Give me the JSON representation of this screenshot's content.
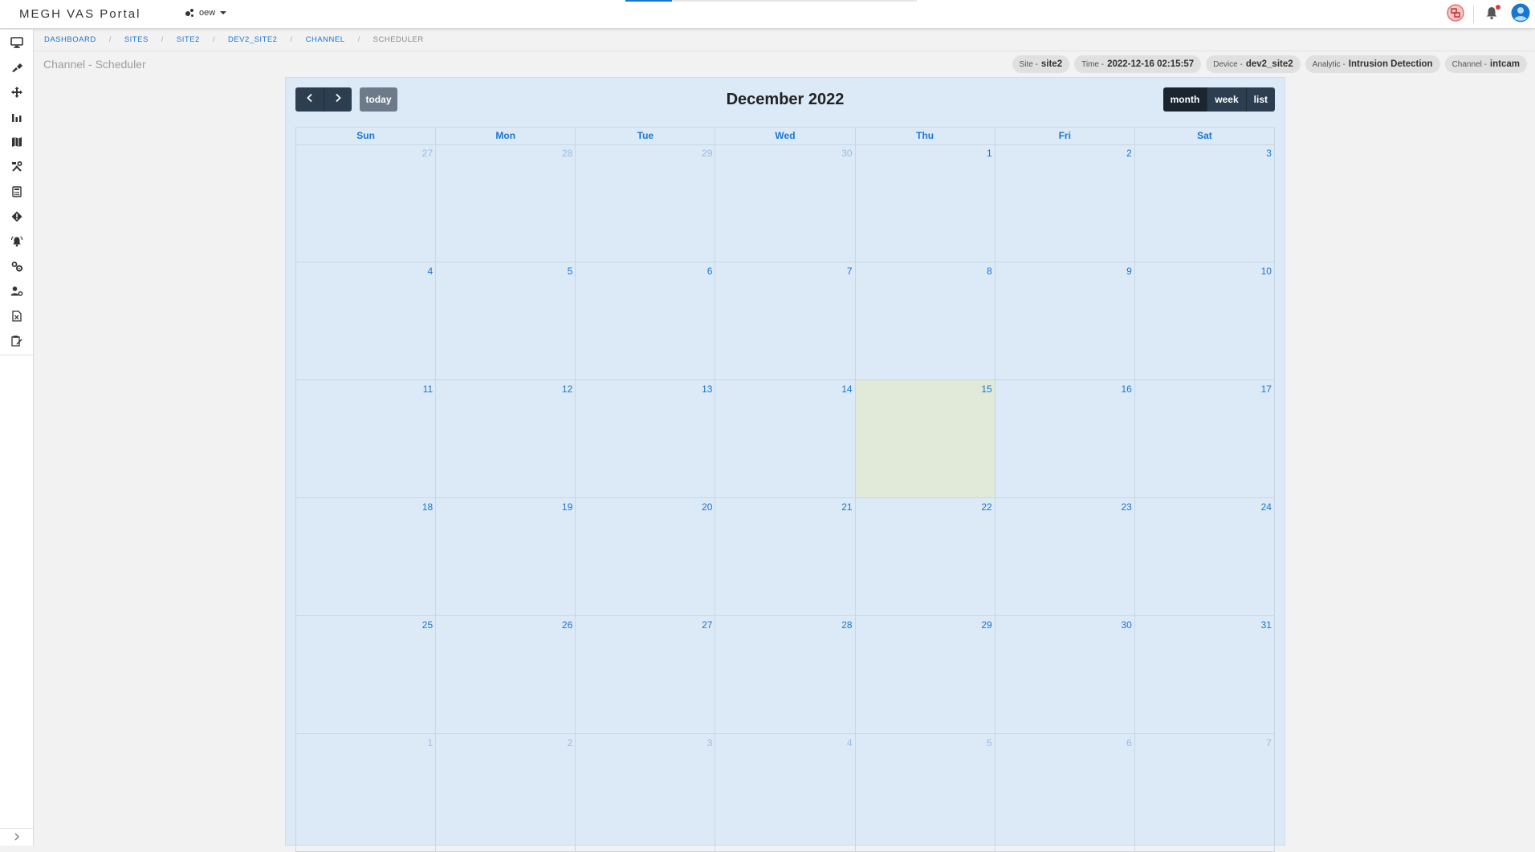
{
  "header": {
    "app_title": "MEGH VAS Portal",
    "org_selector": "oew",
    "loading_progress": 0.16
  },
  "sidebar": {
    "icons": [
      "monitor-icon",
      "tools-brush-icon",
      "move-arrows-icon",
      "bar-chart-icon",
      "map-icon",
      "wrench-hammer-icon",
      "calculator-icon",
      "diamond-alert-icon",
      "alarm-bell-icon",
      "settings-gears-icon",
      "user-settings-icon",
      "excel-file-icon",
      "edit-note-icon"
    ]
  },
  "breadcrumb": {
    "items": [
      "DASHBOARD",
      "SITES",
      "SITE2",
      "DEV2_SITE2",
      "CHANNEL"
    ],
    "current": "SCHEDULER",
    "separator": "/"
  },
  "page_title": "Channel - Scheduler",
  "chips": [
    {
      "label": "Site -",
      "value": "site2"
    },
    {
      "label": "Time -",
      "value": "2022-12-16 02:15:57"
    },
    {
      "label": "Device -",
      "value": "dev2_site2"
    },
    {
      "label": "Analytic -",
      "value": "Intrusion Detection"
    },
    {
      "label": "Channel -",
      "value": "intcam"
    }
  ],
  "calendar": {
    "title": "December 2022",
    "today_label": "today",
    "views": [
      "month",
      "week",
      "list"
    ],
    "active_view": "month",
    "weekdays": [
      "Sun",
      "Mon",
      "Tue",
      "Wed",
      "Thu",
      "Fri",
      "Sat"
    ],
    "weeks": [
      [
        {
          "d": "27",
          "o": true
        },
        {
          "d": "28",
          "o": true
        },
        {
          "d": "29",
          "o": true
        },
        {
          "d": "30",
          "o": true
        },
        {
          "d": "1"
        },
        {
          "d": "2"
        },
        {
          "d": "3"
        }
      ],
      [
        {
          "d": "4"
        },
        {
          "d": "5"
        },
        {
          "d": "6"
        },
        {
          "d": "7"
        },
        {
          "d": "8"
        },
        {
          "d": "9"
        },
        {
          "d": "10"
        }
      ],
      [
        {
          "d": "11"
        },
        {
          "d": "12"
        },
        {
          "d": "13"
        },
        {
          "d": "14"
        },
        {
          "d": "15",
          "t": true
        },
        {
          "d": "16"
        },
        {
          "d": "17"
        }
      ],
      [
        {
          "d": "18"
        },
        {
          "d": "19"
        },
        {
          "d": "20"
        },
        {
          "d": "21"
        },
        {
          "d": "22"
        },
        {
          "d": "23"
        },
        {
          "d": "24"
        }
      ],
      [
        {
          "d": "25"
        },
        {
          "d": "26"
        },
        {
          "d": "27"
        },
        {
          "d": "28"
        },
        {
          "d": "29"
        },
        {
          "d": "30"
        },
        {
          "d": "31"
        }
      ],
      [
        {
          "d": "1",
          "o": true
        },
        {
          "d": "2",
          "o": true
        },
        {
          "d": "3",
          "o": true
        },
        {
          "d": "4",
          "o": true
        },
        {
          "d": "5",
          "o": true
        },
        {
          "d": "6",
          "o": true
        },
        {
          "d": "7",
          "o": true
        }
      ]
    ]
  },
  "colors": {
    "accent": "#1976d2",
    "toolbar_button": "#2c3e50",
    "calendar_bg": "#dce9f7",
    "today_bg": "#e1e9d8"
  }
}
